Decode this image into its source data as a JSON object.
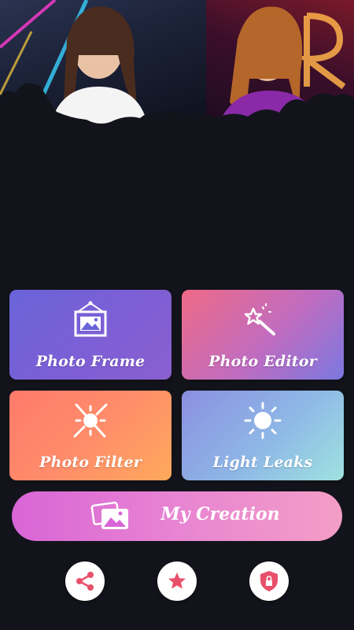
{
  "menu": {
    "photo_frame": "Photo Frame",
    "photo_editor": "Photo Editor",
    "photo_filter": "Photo Filter",
    "light_leaks": "Light Leaks"
  },
  "creation": {
    "label": "My Creation"
  },
  "colors": {
    "background": "#13141b",
    "frame_gradient": [
      "#6a64d8",
      "#8a5fd0"
    ],
    "editor_gradient": [
      "#ee6a86",
      "#7a78e0"
    ],
    "filter_gradient": [
      "#ff7a6a",
      "#ffa95c"
    ],
    "leaks_gradient": [
      "#8a8fe0",
      "#9fe2e0"
    ],
    "creation_gradient": [
      "#d865d6",
      "#f39ec6"
    ],
    "icon_accent": "#e8506a"
  },
  "icons": {
    "photo_frame": "framed-picture-icon",
    "photo_editor": "magic-wand-icon",
    "photo_filter": "filter-icon",
    "light_leaks": "sun-icon",
    "creation": "photos-stack-icon",
    "share": "share-icon",
    "rate": "star-icon",
    "privacy": "shield-lock-icon"
  }
}
